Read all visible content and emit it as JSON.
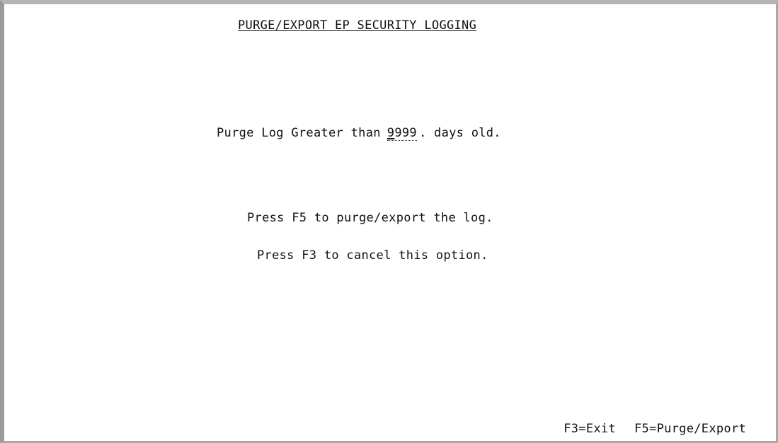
{
  "screen": {
    "title": "PURGE/EXPORT EP SECURITY LOGGING",
    "prompt_label": "Purge Log Greater than",
    "days_value": "9999",
    "days_separator": ".",
    "prompt_suffix": "days old.",
    "instruction_purge": "Press F5 to purge/export the log.",
    "instruction_cancel": "Press F3 to cancel this option."
  },
  "function_keys": [
    {
      "label": "F3=Exit"
    },
    {
      "label": "F5=Purge/Export"
    }
  ]
}
